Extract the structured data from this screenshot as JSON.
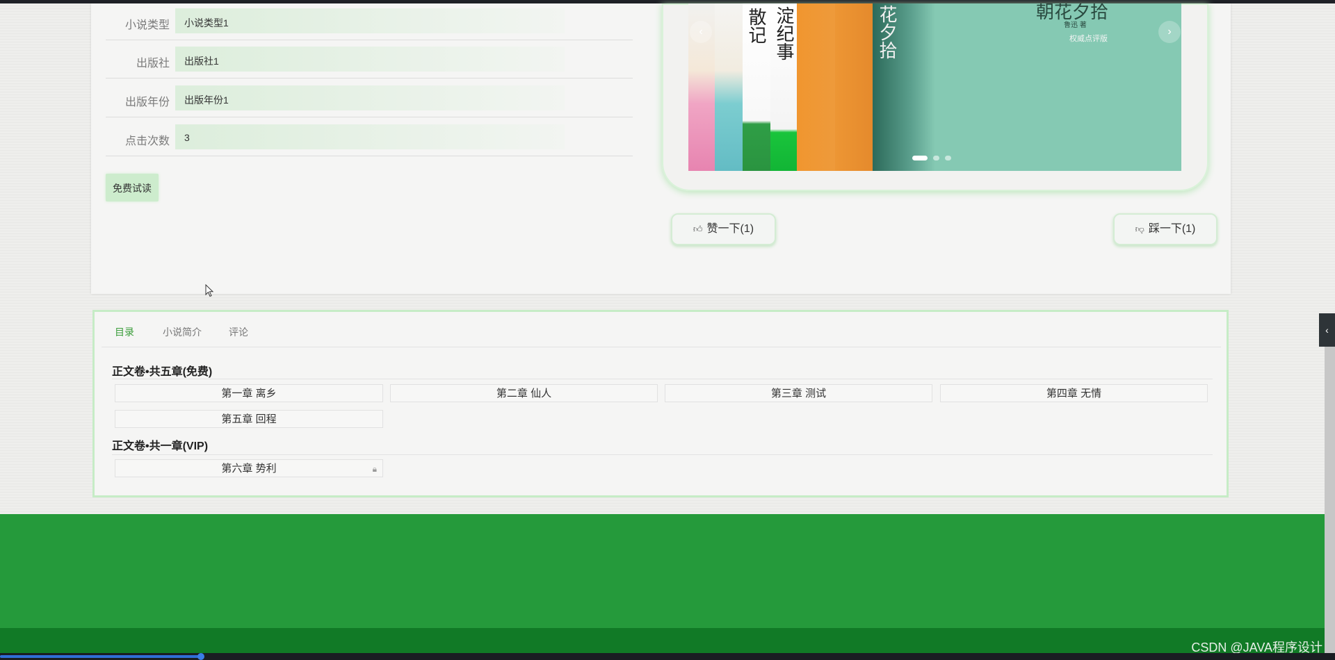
{
  "novel_info": [
    {
      "label": "小说类型",
      "value": "小说类型1"
    },
    {
      "label": "出版社",
      "value": "出版社1"
    },
    {
      "label": "出版年份",
      "value": "出版年份1"
    },
    {
      "label": "点击次数",
      "value": "3"
    }
  ],
  "trial_button": "免费试读",
  "carousel": {
    "titles": [
      "散记",
      "淀纪事",
      "花夕拾"
    ],
    "banner_title": "朝花夕拾",
    "banner_sub1": "鲁迅 著",
    "banner_sub2": "权威点评版",
    "prev_icon": "‹",
    "next_icon": "›"
  },
  "votes": {
    "like": "赞一下(1)",
    "dislike": "踩一下(1)"
  },
  "tabs": [
    "目录",
    "小说简介",
    "评论"
  ],
  "volumes": [
    {
      "title": "正文卷•共五章(免费)",
      "chapters": [
        "第一章 离乡",
        "第二章 仙人",
        "第三章 测试",
        "第四章 无情",
        "第五章 回程"
      ]
    },
    {
      "title": "正文卷•共一章(VIP)",
      "chapters": [
        "第六章 势利"
      ]
    }
  ],
  "watermark": "CSDN @JAVA程序设计",
  "side_toggle_icon": "‹",
  "colors": {
    "accent": "#3a9d3a",
    "footer": "#259a3b",
    "footer_bottom": "#117a26",
    "panel_border": "#c6ecc6"
  }
}
